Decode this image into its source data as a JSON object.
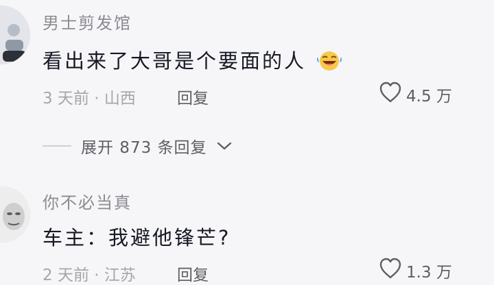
{
  "comments": [
    {
      "username": "男士剪发馆",
      "text": "看出来了大哥是个要面的人",
      "meta": "3 天前 · 山西",
      "reply_label": "回复",
      "likes": "4.5 万",
      "expand_label": "展开 873 条回复"
    },
    {
      "username": "你不必当真",
      "text": "车主：我避他锋芒?",
      "meta": "2 天前 · 江苏",
      "reply_label": "回复",
      "likes": "1.3 万"
    }
  ]
}
